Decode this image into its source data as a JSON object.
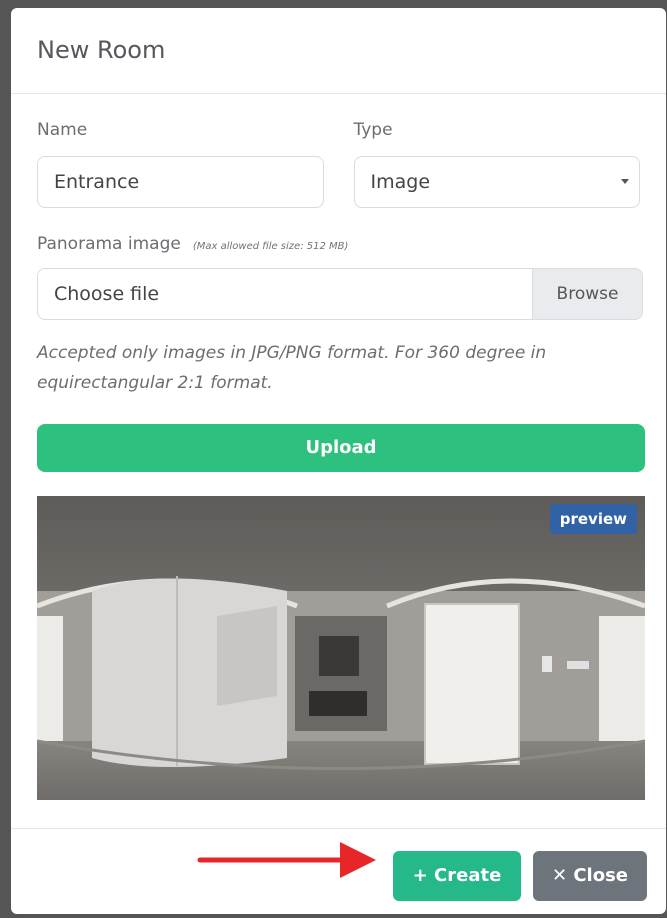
{
  "modal": {
    "title": "New Room",
    "name_label": "Name",
    "name_value": "Entrance",
    "type_label": "Type",
    "type_value": "Image",
    "panorama_label": "Panorama image",
    "max_size_note": "(Max allowed file size: 512 MB)",
    "file_text": "Choose file",
    "browse_label": "Browse",
    "help_text": "Accepted only images in JPG/PNG format. For 360 degree in equirectangular 2:1 format.",
    "upload_label": "Upload",
    "preview_badge": "preview",
    "create_label": "+ Create",
    "close_label": "✕ Close"
  },
  "colors": {
    "upload": "#2ec07e",
    "create": "#24b88a",
    "close": "#6d747c",
    "badge": "#3162a6",
    "arrow": "#e8262a"
  },
  "icons": {
    "select": "chevron-down-icon",
    "annotation": "red-arrow-icon"
  }
}
